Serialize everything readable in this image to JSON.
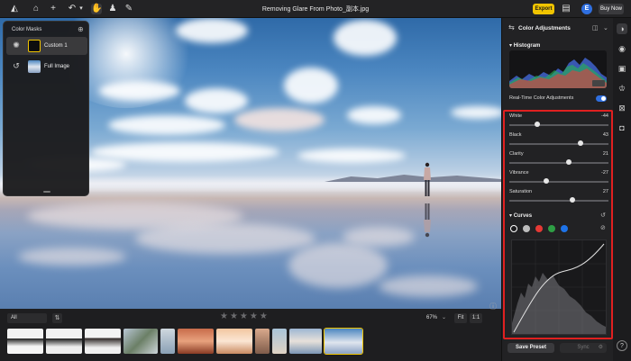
{
  "window": {
    "title": "Removing Glare From Photo_副本.jpg",
    "export_label": "Export",
    "avatar_initial": "E",
    "buy_label": "Buy Now"
  },
  "topbar_icons": [
    "home-icon",
    "plus-icon",
    "undo-icon",
    "chevron-down-icon",
    "hand-icon",
    "stamp-icon",
    "brush-icon"
  ],
  "masks": {
    "title": "Color Masks",
    "items": [
      {
        "label": "Custom 1",
        "selected": true
      },
      {
        "label": "Full Image",
        "selected": false
      }
    ]
  },
  "panel": {
    "title": "Color Adjustments",
    "histogram_label": "Histogram",
    "realtime_label": "Real-Time Color Adjustments",
    "realtime_on": true,
    "sliders": [
      {
        "label": "White",
        "value": "-44",
        "level": 0.28
      },
      {
        "label": "Black",
        "value": "43",
        "level": 0.72
      },
      {
        "label": "Clarity",
        "value": "21",
        "level": 0.6
      },
      {
        "label": "Vibrance",
        "value": "-27",
        "level": 0.37
      },
      {
        "label": "Saturation",
        "value": "27",
        "level": 0.64
      }
    ],
    "curves_label": "Curves",
    "curve_channels": [
      {
        "name": "white",
        "color": "#ffffff"
      },
      {
        "name": "gray",
        "color": "#bdbdbd"
      },
      {
        "name": "red",
        "color": "#e53935"
      },
      {
        "name": "green",
        "color": "#2e9e44"
      },
      {
        "name": "blue",
        "color": "#1e73e8"
      }
    ],
    "save_preset_label": "Save Preset",
    "sync_label": "Sync"
  },
  "bottom": {
    "filter_value": "All",
    "stars": "★★★★★",
    "zoom": "67%",
    "fit_label": "Fit",
    "one_label": "1:1"
  },
  "colors": {
    "accent_yellow": "#f0c400",
    "accent_blue": "#2f6fe0",
    "highlight_red": "#e02020"
  }
}
